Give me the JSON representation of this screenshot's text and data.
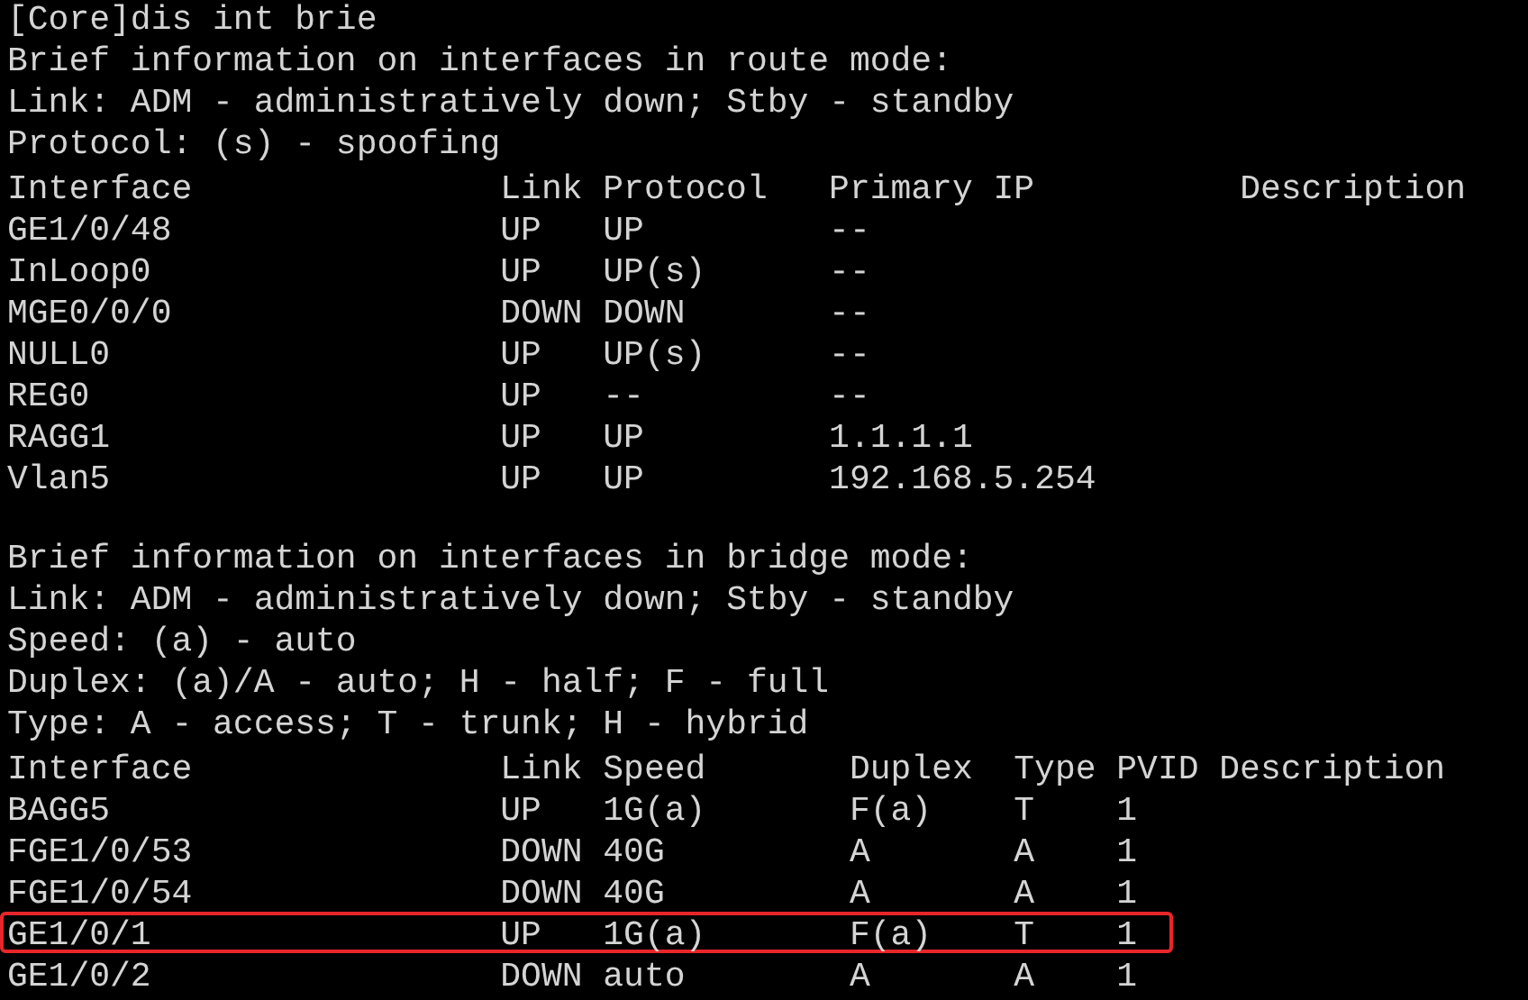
{
  "command": "[Core]dis int brie",
  "sections": [
    {
      "kind": "route",
      "info": [
        "Brief information on interfaces in route mode:",
        "Link: ADM - administratively down; Stby - standby",
        "Protocol: (s) - spoofing"
      ],
      "columns": [
        "Interface",
        "Link",
        "Protocol",
        "Primary IP",
        "Description"
      ],
      "rows": [
        {
          "cells": [
            "GE1/0/48",
            "UP",
            "UP",
            "--"
          ],
          "highlighted": false
        },
        {
          "cells": [
            "InLoop0",
            "UP",
            "UP(s)",
            "--"
          ],
          "highlighted": false
        },
        {
          "cells": [
            "MGE0/0/0",
            "DOWN",
            "DOWN",
            "--"
          ],
          "highlighted": false
        },
        {
          "cells": [
            "NULL0",
            "UP",
            "UP(s)",
            "--"
          ],
          "highlighted": false
        },
        {
          "cells": [
            "REG0",
            "UP",
            "--",
            "--"
          ],
          "highlighted": false
        },
        {
          "cells": [
            "RAGG1",
            "UP",
            "UP",
            "1.1.1.1"
          ],
          "highlighted": false
        },
        {
          "cells": [
            "Vlan5",
            "UP",
            "UP",
            "192.168.5.254"
          ],
          "highlighted": false
        }
      ]
    },
    {
      "kind": "bridge",
      "info": [
        "Brief information on interfaces in bridge mode:",
        "Link: ADM - administratively down; Stby - standby",
        "Speed: (a) - auto",
        "Duplex: (a)/A - auto; H - half; F - full",
        "Type: A - access; T - trunk; H - hybrid"
      ],
      "columns": [
        "Interface",
        "Link",
        "Speed",
        "Duplex",
        "Type",
        "PVID",
        "Description"
      ],
      "rows": [
        {
          "cells": [
            "BAGG5",
            "UP",
            "1G(a)",
            "F(a)",
            "T",
            "1"
          ],
          "highlighted": false
        },
        {
          "cells": [
            "FGE1/0/53",
            "DOWN",
            "40G",
            "A",
            "A",
            "1"
          ],
          "highlighted": false
        },
        {
          "cells": [
            "FGE1/0/54",
            "DOWN",
            "40G",
            "A",
            "A",
            "1"
          ],
          "highlighted": false
        },
        {
          "cells": [
            "GE1/0/1",
            "UP",
            "1G(a)",
            "F(a)",
            "T",
            "1"
          ],
          "highlighted": true
        },
        {
          "cells": [
            "GE1/0/2",
            "DOWN",
            "auto",
            "A",
            "A",
            "1"
          ],
          "highlighted": false
        }
      ]
    }
  ]
}
